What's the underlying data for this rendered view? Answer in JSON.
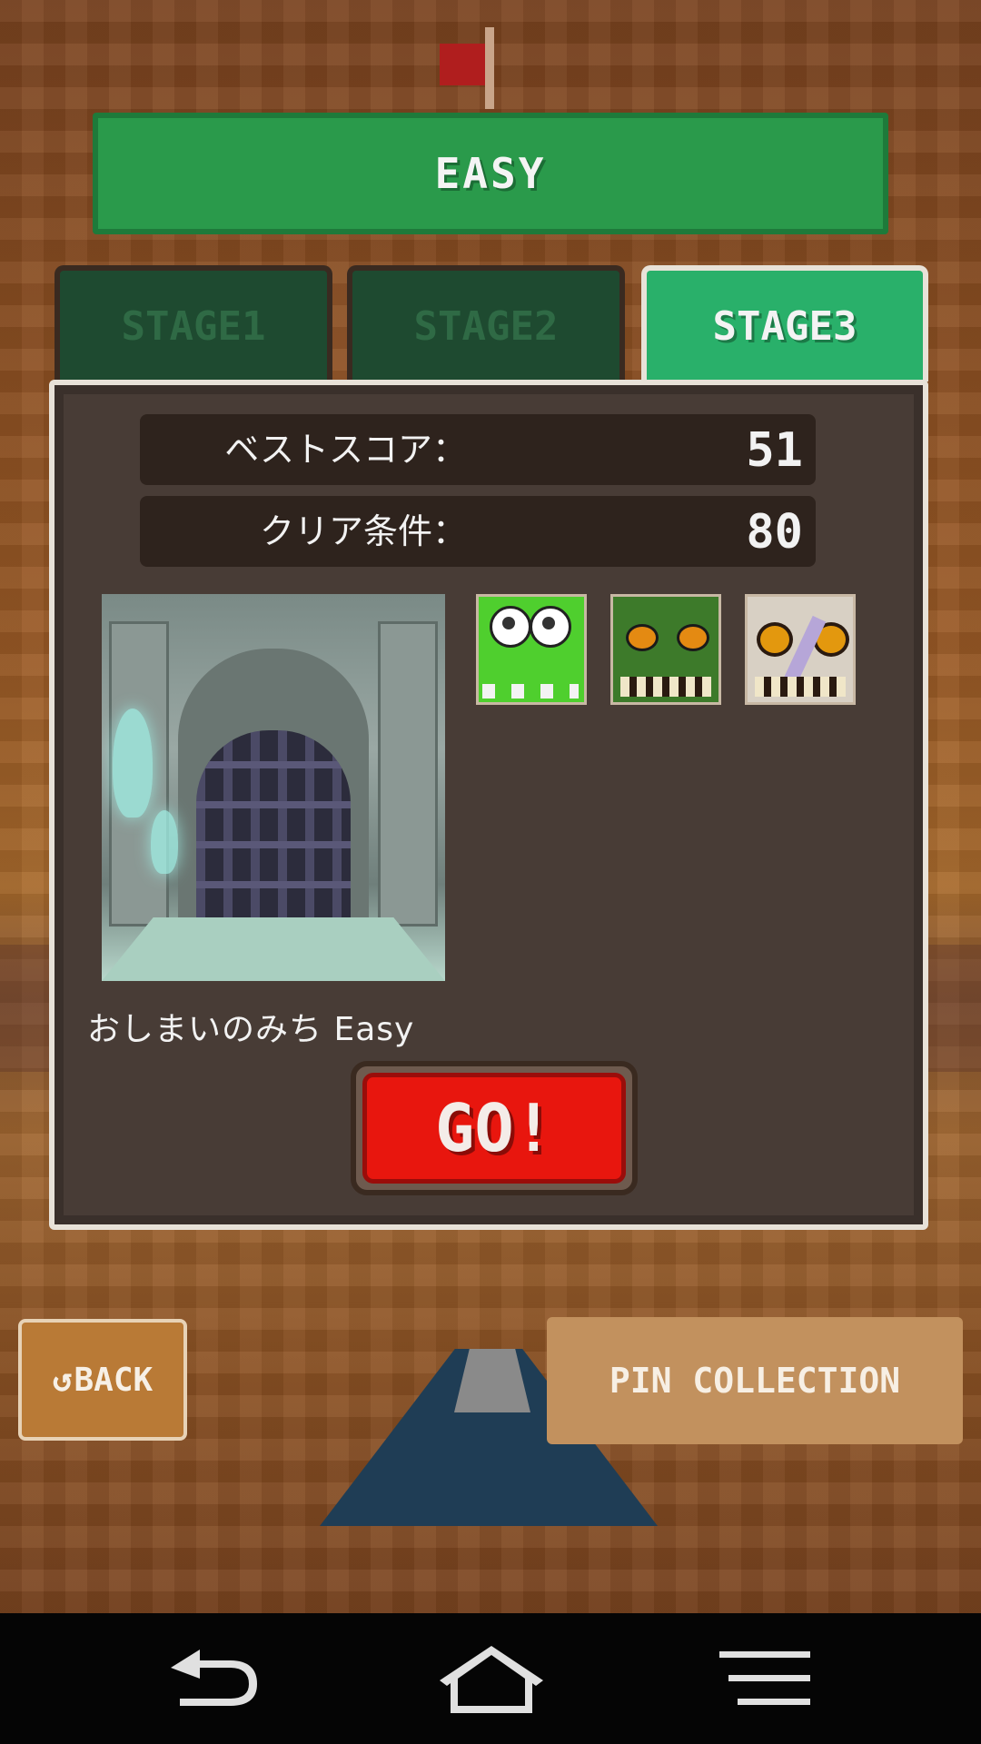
{
  "difficulty": {
    "label": "EASY"
  },
  "tabs": [
    {
      "label": "STAGE1",
      "active": false
    },
    {
      "label": "STAGE2",
      "active": false
    },
    {
      "label": "STAGE3",
      "active": true
    }
  ],
  "stats": {
    "best_score_label": "ベストスコア：",
    "best_score_value": "51",
    "clear_condition_label": "クリア条件：",
    "clear_condition_value": "80"
  },
  "stage": {
    "name": "おしまいのみち Easy",
    "enemies": [
      "green-blob-enemy",
      "green-zombie-enemy",
      "skull-enemy"
    ]
  },
  "buttons": {
    "go": "GO!",
    "back": "BACK",
    "back_icon": "return-arrow-icon",
    "pin_collection": "PIN COLLECTION"
  },
  "nav": {
    "back_icon": "back-icon",
    "home_icon": "home-icon",
    "menu_icon": "menu-icon"
  },
  "colors": {
    "difficulty_green": "#2a9a4b",
    "active_tab": "#29b06a",
    "inactive_tab": "#1e4a30",
    "panel": "#483c36",
    "go_red": "#e8160e",
    "back_brown": "#b97a36",
    "pin_tan": "#c2915e"
  }
}
